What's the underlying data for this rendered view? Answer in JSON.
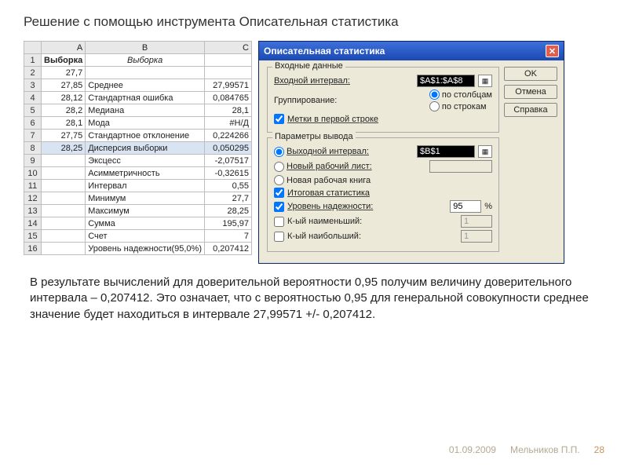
{
  "page": {
    "title": "Решение с помощью инструмента Описательная статистика",
    "body_text": "В результате вычислений для доверительной вероятности 0,95 получим величину доверительного интервала – 0,207412. Это означает, что с вероятностью 0,95 для генеральной совокупности среднее значение будет находиться в интервале 27,99571 +/- 0,207412.",
    "footer_date": "01.09.2009",
    "footer_author": "Мельников П.П.",
    "footer_page": "28"
  },
  "sheet": {
    "cols": [
      "A",
      "B",
      "C"
    ],
    "header": {
      "A": "Выборка",
      "B": "Выборка"
    },
    "rows": [
      {
        "n": "2",
        "A": "27,7",
        "B": "",
        "C": ""
      },
      {
        "n": "3",
        "A": "27,85",
        "B": "Среднее",
        "C": "27,99571"
      },
      {
        "n": "4",
        "A": "28,12",
        "B": "Стандартная ошибка",
        "C": "0,084765"
      },
      {
        "n": "5",
        "A": "28,2",
        "B": "Медиана",
        "C": "28,1"
      },
      {
        "n": "6",
        "A": "28,1",
        "B": "Мода",
        "C": "#Н/Д"
      },
      {
        "n": "7",
        "A": "27,75",
        "B": "Стандартное отклонение",
        "C": "0,224266"
      },
      {
        "n": "8",
        "A": "28,25",
        "B": "Дисперсия выборки",
        "C": "0,050295",
        "sel": true
      },
      {
        "n": "9",
        "A": "",
        "B": "Эксцесс",
        "C": "-2,07517"
      },
      {
        "n": "10",
        "A": "",
        "B": "Асимметричность",
        "C": "-0,32615"
      },
      {
        "n": "11",
        "A": "",
        "B": "Интервал",
        "C": "0,55"
      },
      {
        "n": "12",
        "A": "",
        "B": "Минимум",
        "C": "27,7"
      },
      {
        "n": "13",
        "A": "",
        "B": "Максимум",
        "C": "28,25"
      },
      {
        "n": "14",
        "A": "",
        "B": "Сумма",
        "C": "195,97"
      },
      {
        "n": "15",
        "A": "",
        "B": "Счет",
        "C": "7"
      },
      {
        "n": "16",
        "A": "",
        "B": "Уровень надежности(95,0%)",
        "C": "0,207412"
      }
    ]
  },
  "dialog": {
    "title": "Описательная статистика",
    "btn_ok": "OK",
    "btn_cancel": "Отмена",
    "btn_help": "Справка",
    "group_input": "Входные данные",
    "label_input_range": "Входной интервал:",
    "input_range": "$A$1:$A$8",
    "label_grouping": "Группирование:",
    "radio_cols": "по столбцам",
    "radio_rows": "по строкам",
    "check_header": "Метки в первой строке",
    "group_output": "Параметры вывода",
    "radio_out_range": "Выходной интервал:",
    "out_range": "$B$1",
    "radio_new_sheet": "Новый рабочий лист:",
    "radio_new_book": "Новая рабочая книга",
    "check_summary": "Итоговая статистика",
    "check_conf": "Уровень надежности:",
    "conf_val": "95",
    "conf_pct": "%",
    "check_kmin": "К-ый наименьший:",
    "kmin_val": "1",
    "check_kmax": "К-ый наибольший:",
    "kmax_val": "1"
  }
}
